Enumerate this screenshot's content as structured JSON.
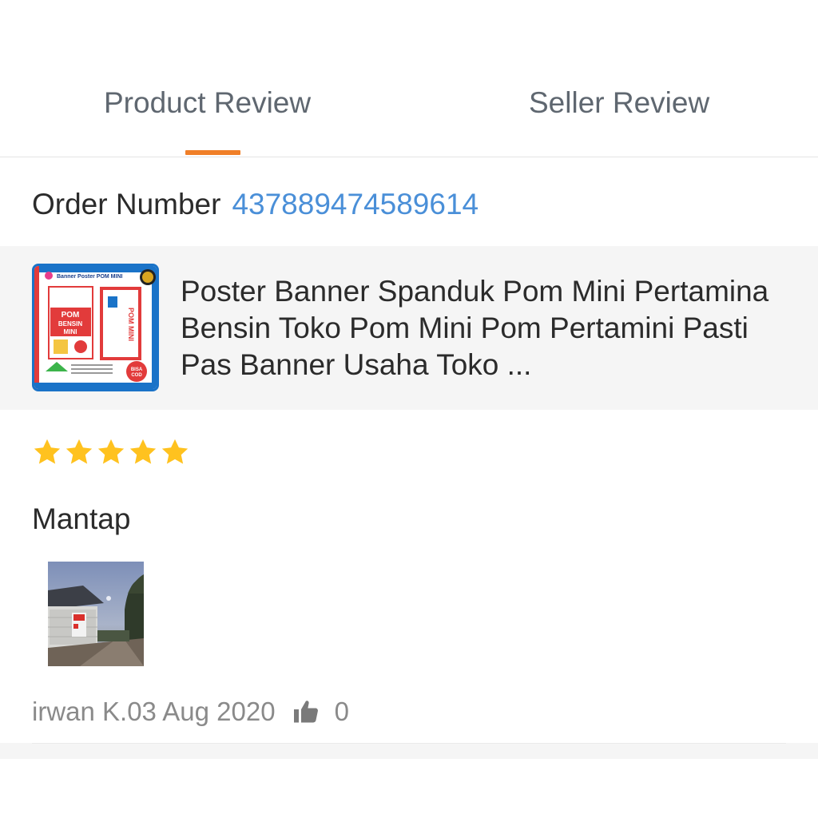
{
  "tabs": {
    "product_review": "Product Review",
    "seller_review": "Seller Review",
    "active": "product_review",
    "accent_color": "#f07f28"
  },
  "order": {
    "label": "Order Number",
    "number": "437889474589614",
    "number_color": "#4a8fd8"
  },
  "product": {
    "title": "Poster Banner Spanduk Pom Mini Pertamina Bensin Toko Pom Mini Pom Pertamini Pasti Pas Banner Usaha Toko ...",
    "thumbnail": {
      "header": "Banner Poster POM MINI",
      "sign_title": "POM BENSIN MINI",
      "side_sign": "POM MINI",
      "badge": "BISA COD"
    }
  },
  "review": {
    "rating": 5,
    "max_rating": 5,
    "star_color": "#ffc21f",
    "text": "Mantap",
    "photo_icon": "review-photo",
    "author_date": "irwan K.03 Aug 2020",
    "likes": "0",
    "like_icon": "thumbs-up-icon"
  }
}
